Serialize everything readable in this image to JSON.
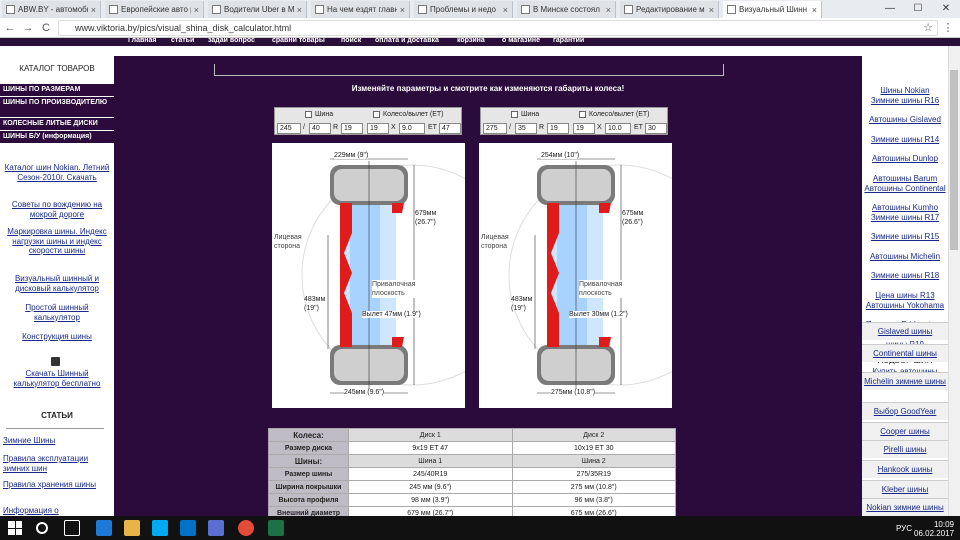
{
  "browser": {
    "tabs": [
      {
        "label": "ABW.BY - автомоби",
        "icon_text": "AB"
      },
      {
        "label": "Европейские авто р",
        "icon_text": ""
      },
      {
        "label": "Водители Uber в М",
        "icon_text": ""
      },
      {
        "label": "На чем ездят главн",
        "icon_text": ""
      },
      {
        "label": "Проблемы и недо",
        "icon_text": ""
      },
      {
        "label": "В Минске состоял",
        "icon_text": ""
      },
      {
        "label": "Редактирование м",
        "icon_text": "D"
      },
      {
        "label": "Визуальный Шинн",
        "icon_text": ""
      }
    ],
    "url": "www.viktoria.by/pics/visual_shina_disk_calculator.html",
    "close_glyph": "×",
    "win": {
      "min": "—",
      "max": "☐",
      "close": "✕"
    },
    "nav": {
      "back": "←",
      "forward": "→",
      "reload": "C",
      "star": "☆",
      "menu": "⋮"
    }
  },
  "site_top": [
    "Главная",
    "статьи",
    "задай вопрос",
    "сравни товары",
    "поиск",
    "оплата и доставка",
    "корзина",
    "о магазине",
    "гарантии"
  ],
  "left": {
    "catalog_title": "КАТАЛОГ ТОВАРОВ",
    "categories": [
      "ШИНЫ ПО РАЗМЕРАМ",
      "ШИНЫ ПО ПРОИЗВОДИТЕЛЮ",
      "КОЛЕСНЫЕ ЛИТЫЕ ДИСКИ",
      "ШИНЫ Б/У (информация)"
    ],
    "links": [
      "Каталог шин Nokian. Летний Сезон-2010г. Скачать",
      "Советы по вождению на мокрой дороге",
      "Маркировка шины. Индекс нагрузки шины и индекс скорости шины",
      "Визуальный шинный и дисковый калькулятор",
      "Простой шинный калькулятор",
      "Конструкция шины"
    ],
    "download_label": "Скачать Шинный калькулятор бесплатно",
    "articles_head": "СТАТЬИ",
    "articles": [
      "Зимние Шины",
      "Правила эксплуатации зимних шин",
      "Правила хранения шины",
      "Информация о"
    ]
  },
  "main": {
    "subtitle": "Изменяйте параметры и смотрите как изменяются габариты колеса!",
    "calc": [
      {
        "tire_label": "Шина",
        "disk_label": "Колесо/вылет (ET)",
        "width": "245",
        "profile": "40",
        "r_label": "R",
        "rim": "19",
        "rim2": "19",
        "x": "X",
        "rim_w": "9.0",
        "et_label": "ET",
        "et": "47",
        "slash": "/",
        "dim_top": "229мм (9\")",
        "dim_right": "679мм (26.7\")",
        "dim_left": "483мм (19\")",
        "dim_bottom": "245мм (9.6\")",
        "offset": "Вылет 47мм (1.9\")"
      },
      {
        "tire_label": "Шина",
        "disk_label": "Колесо/вылет (ET)",
        "width": "275",
        "profile": "35",
        "r_label": "R",
        "rim": "19",
        "rim2": "19",
        "x": "X",
        "rim_w": "10.0",
        "et_label": "ET",
        "et": "30",
        "slash": "/",
        "dim_top": "254мм (10\")",
        "dim_right": "675мм (26.6\")",
        "dim_left": "483мм (19\")",
        "dim_bottom": "275мм (10.8\")",
        "offset": "Вылет 30мм (1.2\")"
      }
    ],
    "face_label": "Лицевая сторона",
    "plane_label": "Привалочная плоскость",
    "table": {
      "wheels_h": "Колеса:",
      "disk1": "Диск 1",
      "disk2": "Диск 2",
      "rows1": [
        [
          "Размер диска",
          "9x19 ET 47",
          "10x19 ET 30"
        ]
      ],
      "tires_h": "Шины:",
      "tire1": "Шина 1",
      "tire2": "Шина 2",
      "rows2": [
        [
          "Размер шины",
          "245/40R19",
          "275/35R19"
        ],
        [
          "Ширина покрышки",
          "245 мм (9.6\")",
          "275 мм (10.8\")"
        ],
        [
          "Высота профиля",
          "98 мм (3.9\")",
          "96 мм (3.8\")"
        ],
        [
          "Внешний диаметр",
          "679 мм (26.7\")",
          "675 мм (26.6\")"
        ]
      ]
    }
  },
  "right": {
    "links": [
      "Шины Nokian",
      "Зимние шины R16",
      "Автошины Gislaved",
      "Зимние шины R14",
      "Автошины Dunlop",
      "Автошины Barum",
      "Автошины Continental",
      "Автошины Kumho",
      "Зимние шины R17",
      "Зимние шины R15",
      "Автошины Michelin",
      "Зимние шины R18",
      "Цена шины R13",
      "Автошины Yokohama",
      "Продажа Bridgestone Цены",
      "шины R19"
    ],
    "pick_label": "ПОДБОР ШИН",
    "pick_links": [
      "Купить автошины Dunlop"
    ],
    "boxes": [
      "Gislaved шины",
      "Continental шины",
      "Michelin зимние шины",
      "Выбор GoodYear",
      "Cooper шины",
      "Pirelli шины",
      "Hankook шины",
      "Kleber шины",
      "Nokian зимние шины"
    ]
  },
  "taskbar": {
    "time": "10:09",
    "date": "06.02.2017",
    "lang": "РУС"
  }
}
